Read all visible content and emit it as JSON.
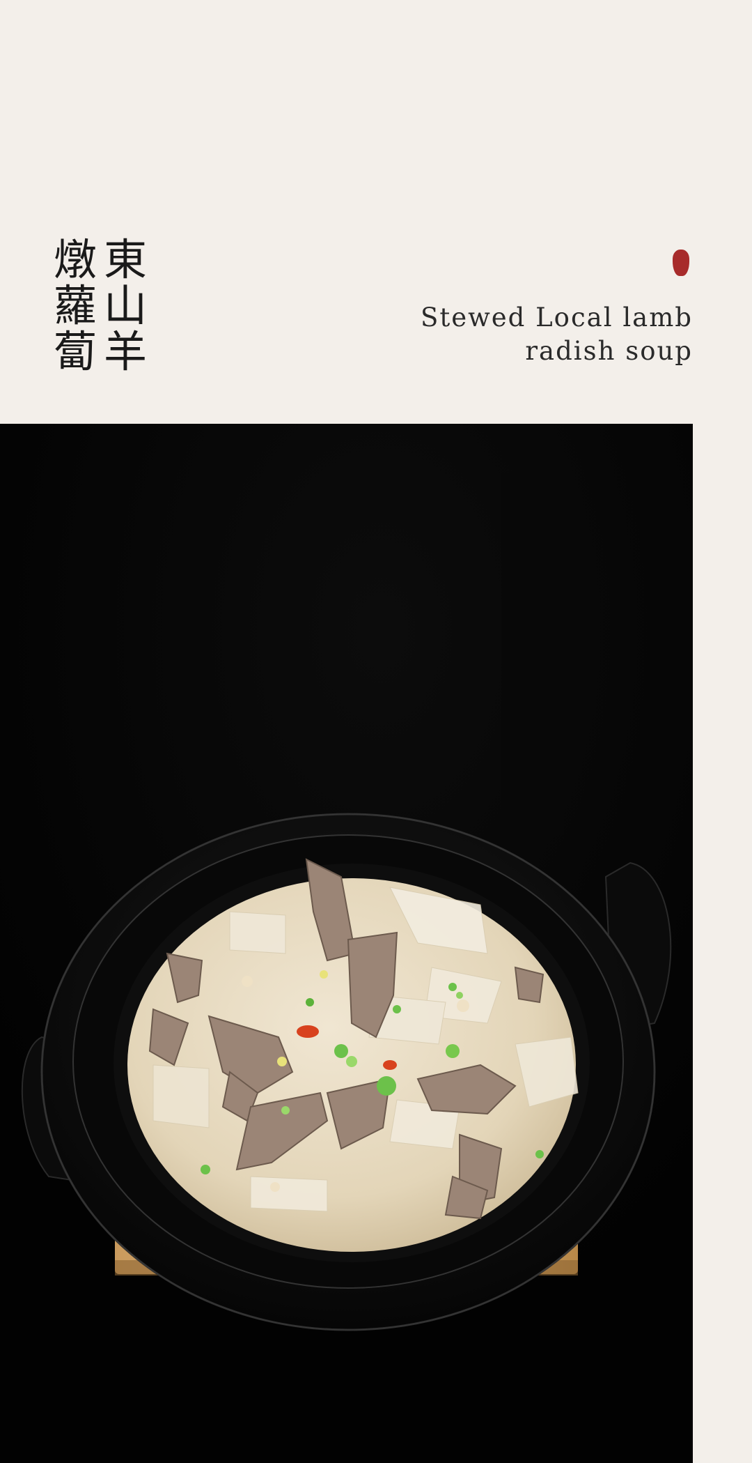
{
  "title_cn": {
    "column_right": [
      "東",
      "山",
      "羊"
    ],
    "column_left": [
      "燉",
      "蘿",
      "蔔"
    ]
  },
  "seal": {
    "text": "",
    "color": "#a72b2b"
  },
  "title_en": {
    "line1": "Stewed Local lamb",
    "line2": "radish soup"
  },
  "photo": {
    "subject": "clay-pot-lamb-radish-soup",
    "background_color": "#020202",
    "broth_color": "#e8dcc4"
  }
}
